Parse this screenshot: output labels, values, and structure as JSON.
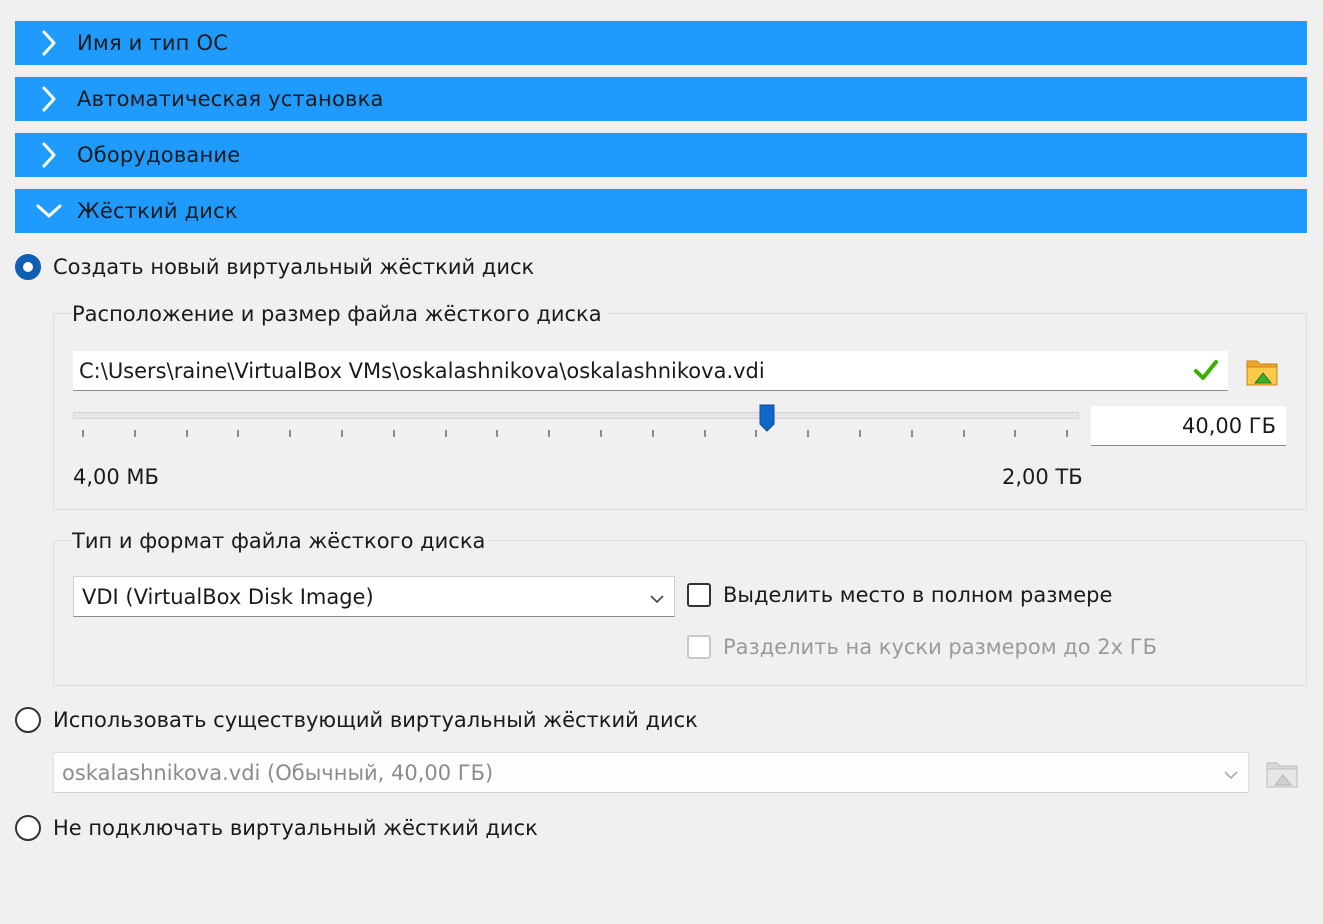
{
  "sections": [
    {
      "label": "Имя и тип ОС",
      "expanded": false
    },
    {
      "label": "Автоматическая установка",
      "expanded": false
    },
    {
      "label": "Оборудование",
      "expanded": false
    },
    {
      "label": "Жёсткий диск",
      "expanded": true
    }
  ],
  "options": {
    "create_new": "Создать новый виртуальный жёсткий диск",
    "use_existing": "Использовать существующий виртуальный жёсткий диск",
    "no_disk": "Не подключать виртуальный жёсткий диск",
    "selected": "create_new"
  },
  "location_group": {
    "title": "Расположение и размер файла жёсткого диска",
    "path": "C:\\Users\\raine\\VirtualBox VMs\\oskalashnikova\\oskalashnikova.vdi",
    "size_value": "40,00 ГБ",
    "min_label": "4,00 МБ",
    "max_label": "2,00 ТБ",
    "slider_fraction": 0.69
  },
  "format_group": {
    "title": "Тип и формат файла жёсткого диска",
    "format_selected": "VDI (VirtualBox Disk Image)",
    "preallocate_label": "Выделить место в полном размере",
    "preallocate_checked": false,
    "split_label": "Разделить на куски размером до 2х ГБ",
    "split_checked": false,
    "split_enabled": false
  },
  "existing_disk": {
    "selected": "oskalashnikova.vdi (Обычный, 40,00 ГБ)"
  },
  "colors": {
    "header_bg": "#1e9bfd",
    "radio_checked": "#0f5fb5",
    "check_green": "#38b000"
  }
}
